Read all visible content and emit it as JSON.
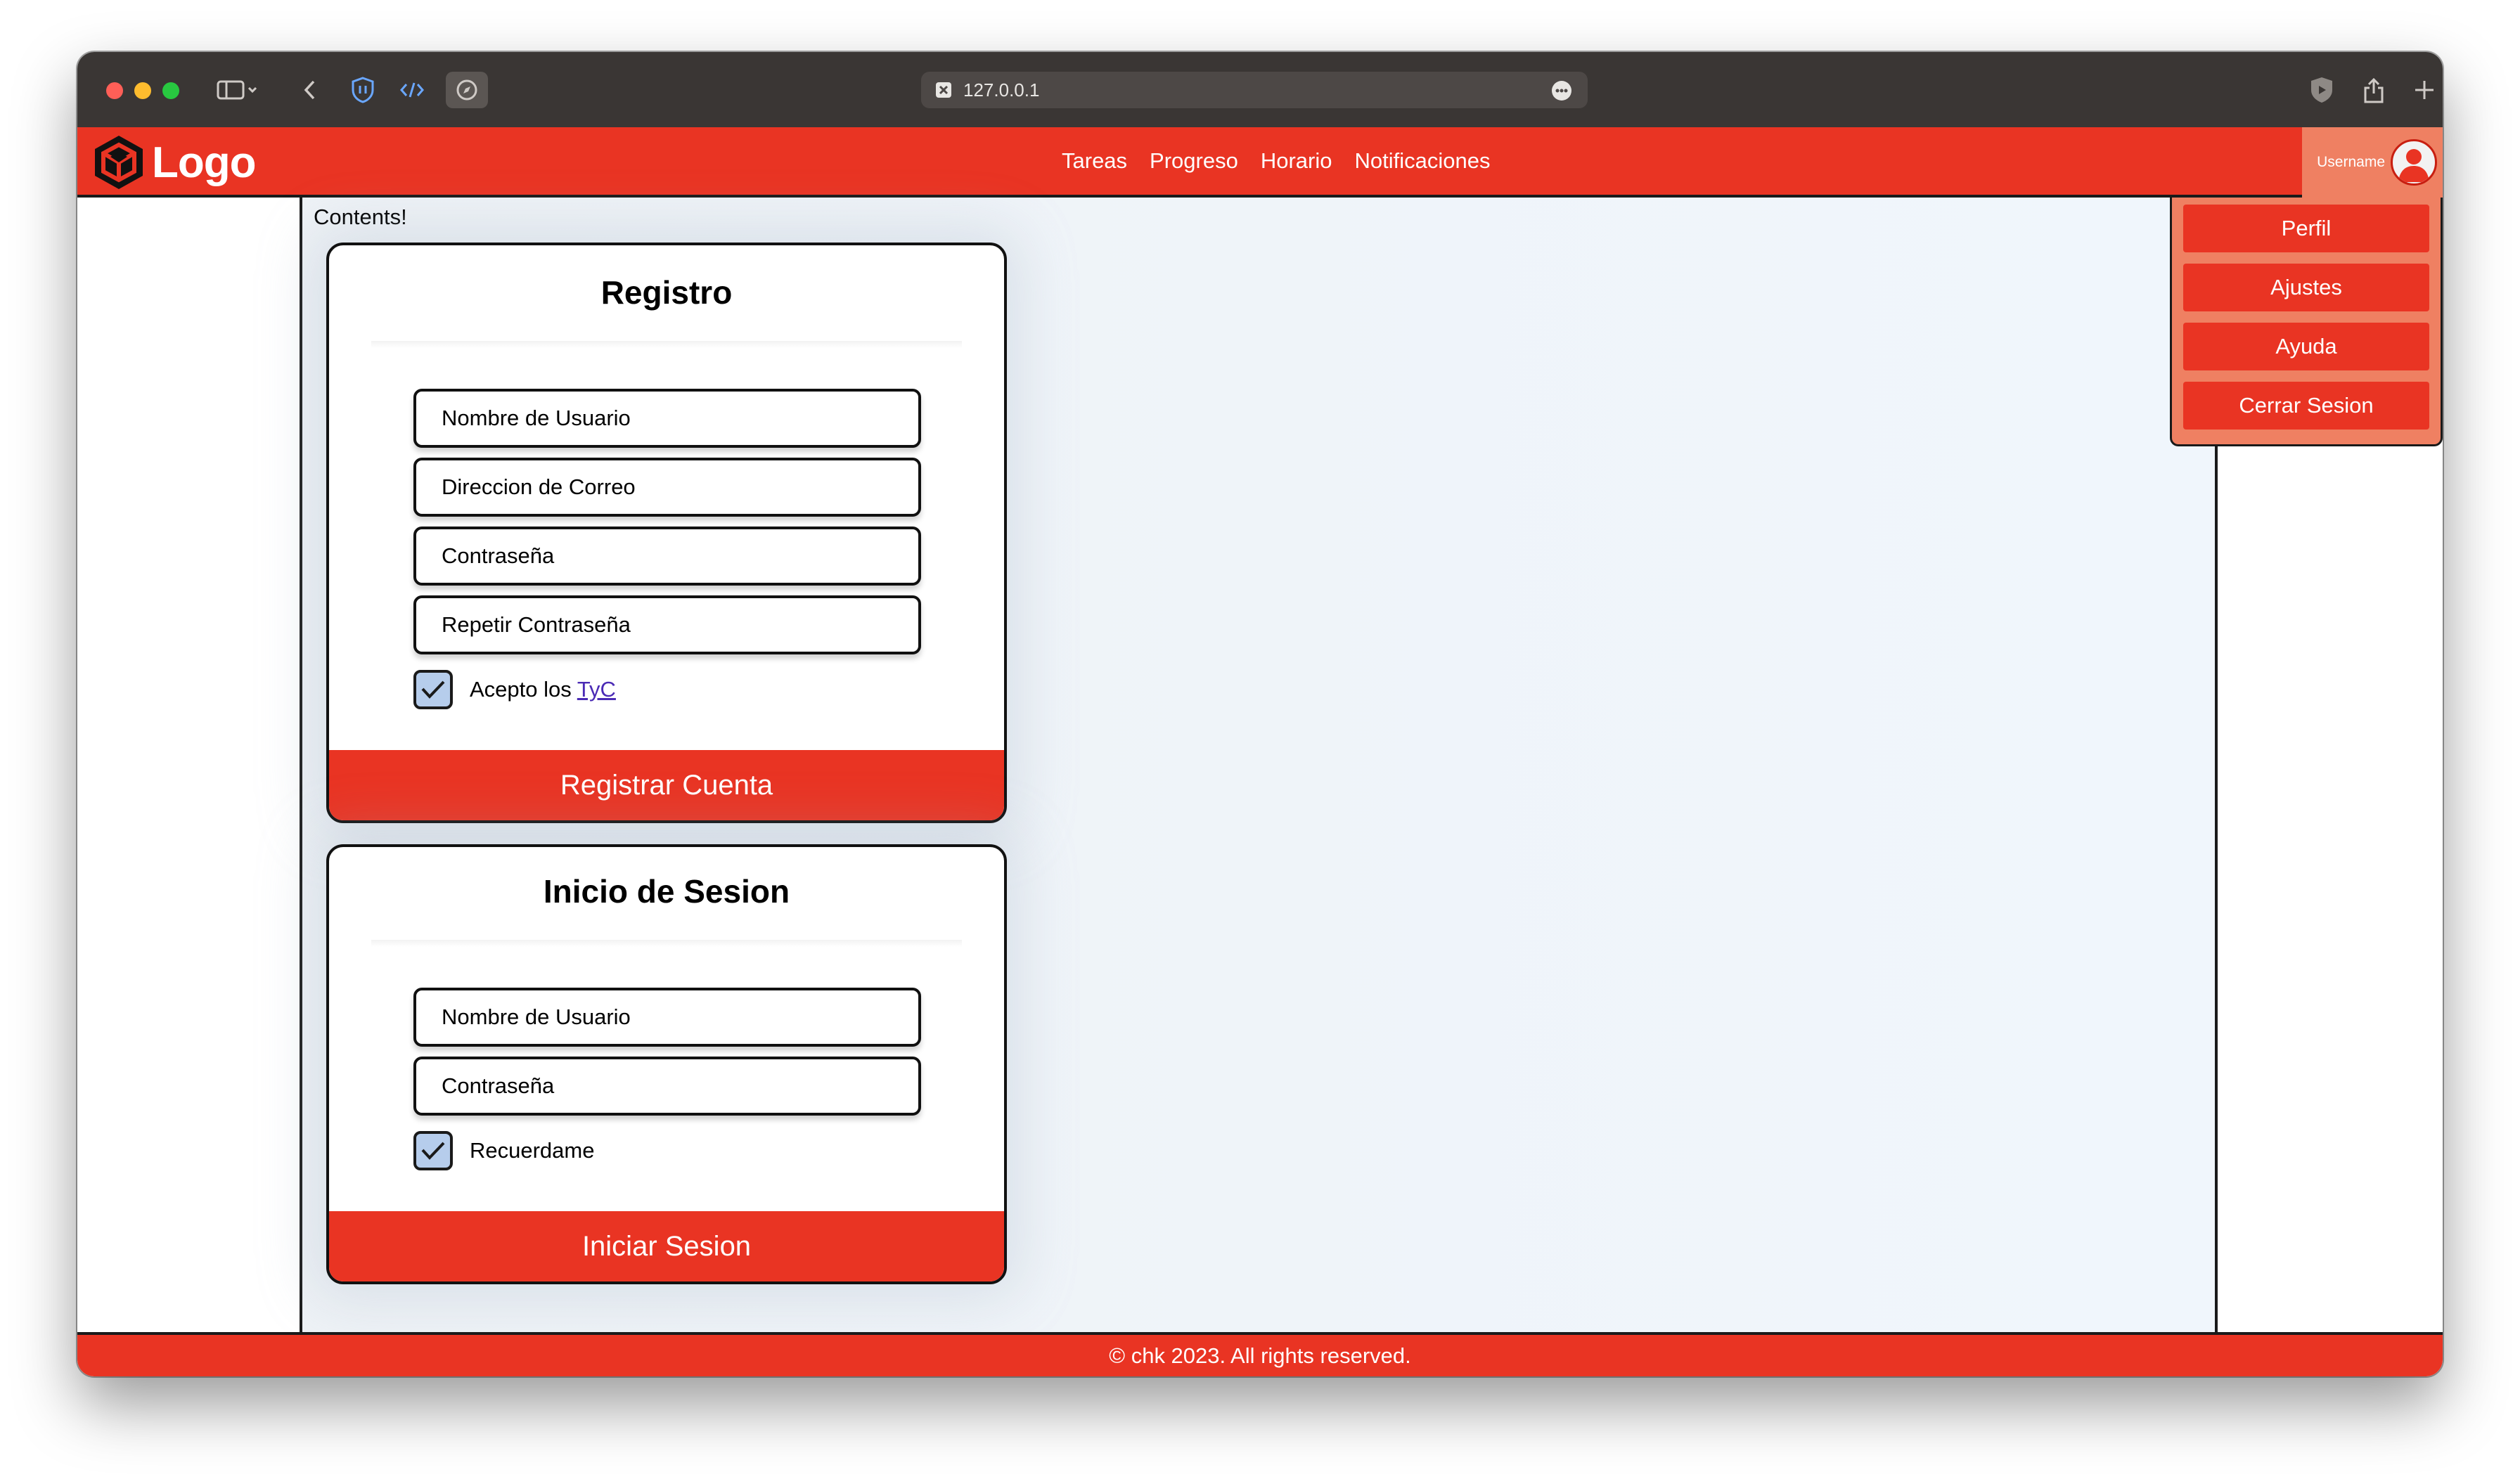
{
  "browser": {
    "url": "127.0.0.1"
  },
  "navbar": {
    "logo_text": "Logo",
    "links": [
      "Tareas",
      "Progreso",
      "Horario",
      "Notificaciones"
    ],
    "username": "Username"
  },
  "user_menu": {
    "items": [
      "Perfil",
      "Ajustes",
      "Ayuda",
      "Cerrar Sesion"
    ]
  },
  "content": {
    "label": "Contents!"
  },
  "register": {
    "title": "Registro",
    "username_placeholder": "Nombre de Usuario",
    "email_placeholder": "Direccion de Correo",
    "password_placeholder": "Contraseña",
    "repeat_password_placeholder": "Repetir Contraseña",
    "terms_prefix": "Acepto los ",
    "terms_link": "TyC",
    "terms_checked": true,
    "submit_label": "Registrar Cuenta"
  },
  "login": {
    "title": "Inicio de Sesion",
    "username_placeholder": "Nombre de Usuario",
    "password_placeholder": "Contraseña",
    "remember_label": "Recuerdame",
    "remember_checked": true,
    "submit_label": "Iniciar Sesion"
  },
  "footer": {
    "text": "© chk 2023. All rights reserved."
  },
  "colors": {
    "brand_red": "#e93423",
    "accent_salmon": "#ef8062",
    "checkbox_fill": "#b6cdec"
  },
  "icons": {
    "logo": "hexagon-cube-logo-icon",
    "avatar": "user-avatar-icon",
    "checkbox": "checkmark-icon"
  }
}
